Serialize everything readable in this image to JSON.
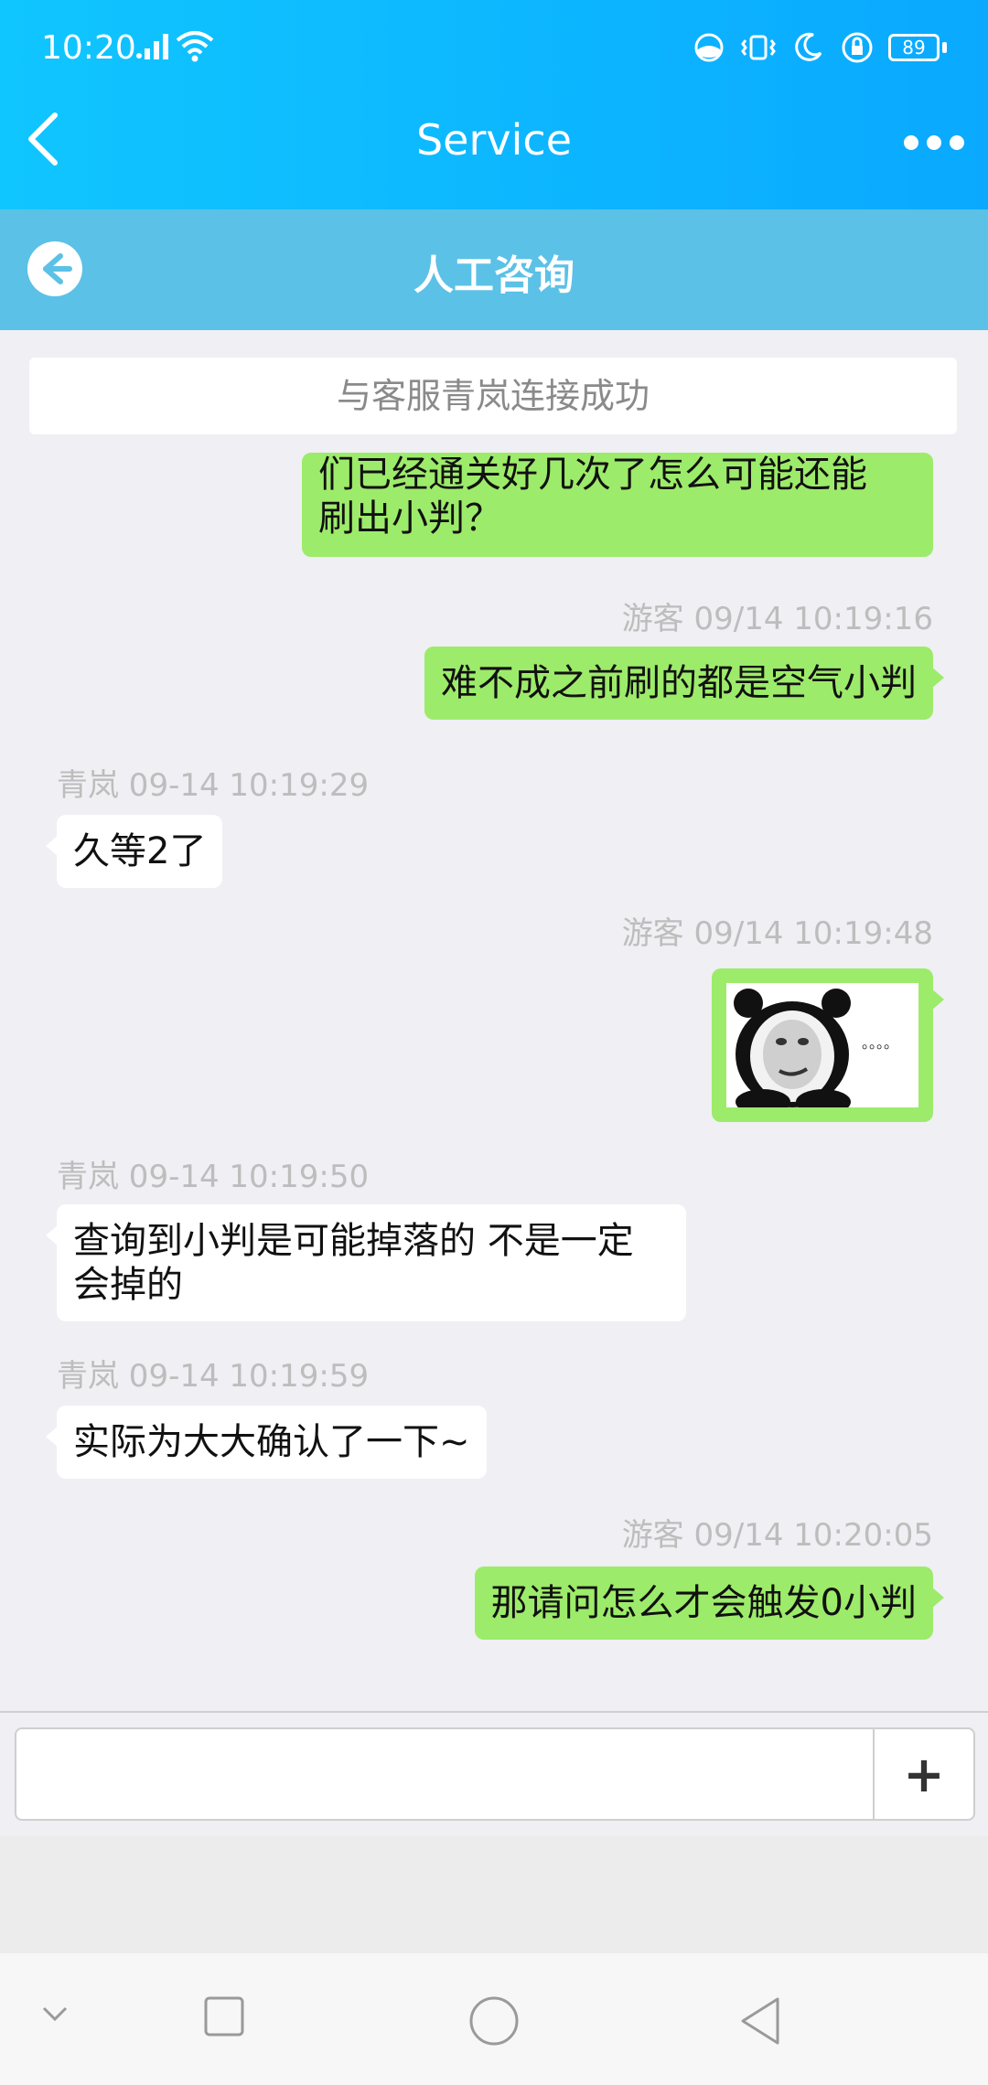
{
  "status_bar": {
    "time": "10:20",
    "battery": "89"
  },
  "app_bar": {
    "title": "Service"
  },
  "sub_header": {
    "title": "人工咨询"
  },
  "chat": {
    "system_banner": "与客服青岚连接成功",
    "messages": [
      {
        "from": "visitor",
        "meta": "",
        "text_line1": "们已经通关好几次了怎么可能还能",
        "text_line2": "刷出小判？"
      },
      {
        "from": "visitor",
        "meta": "游客 09/14 10:19:16",
        "text": "难不成之前刷的都是空气小判"
      },
      {
        "from": "agent",
        "meta": "青岚 09-14 10:19:29",
        "text": "久等2了"
      },
      {
        "from": "visitor",
        "meta": "游客 09/14 10:19:48",
        "sticker_caption": "。。。。"
      },
      {
        "from": "agent",
        "meta": "青岚 09-14 10:19:50",
        "text_line1": "查询到小判是可能掉落的 不是一定",
        "text_line2": "会掉的"
      },
      {
        "from": "agent",
        "meta": "青岚 09-14 10:19:59",
        "text": "实际为大大确认了一下~"
      },
      {
        "from": "visitor",
        "meta": "游客 09/14 10:20:05",
        "text": "那请问怎么才会触发0小判"
      }
    ]
  },
  "input": {
    "placeholder": "",
    "plus_label": "+"
  },
  "colors": {
    "app_bar": "#10c6ff",
    "sub_header": "#5bc1e6",
    "visitor_bubble": "#9deb6a",
    "agent_bubble": "#ffffff",
    "background": "#efeff4"
  }
}
